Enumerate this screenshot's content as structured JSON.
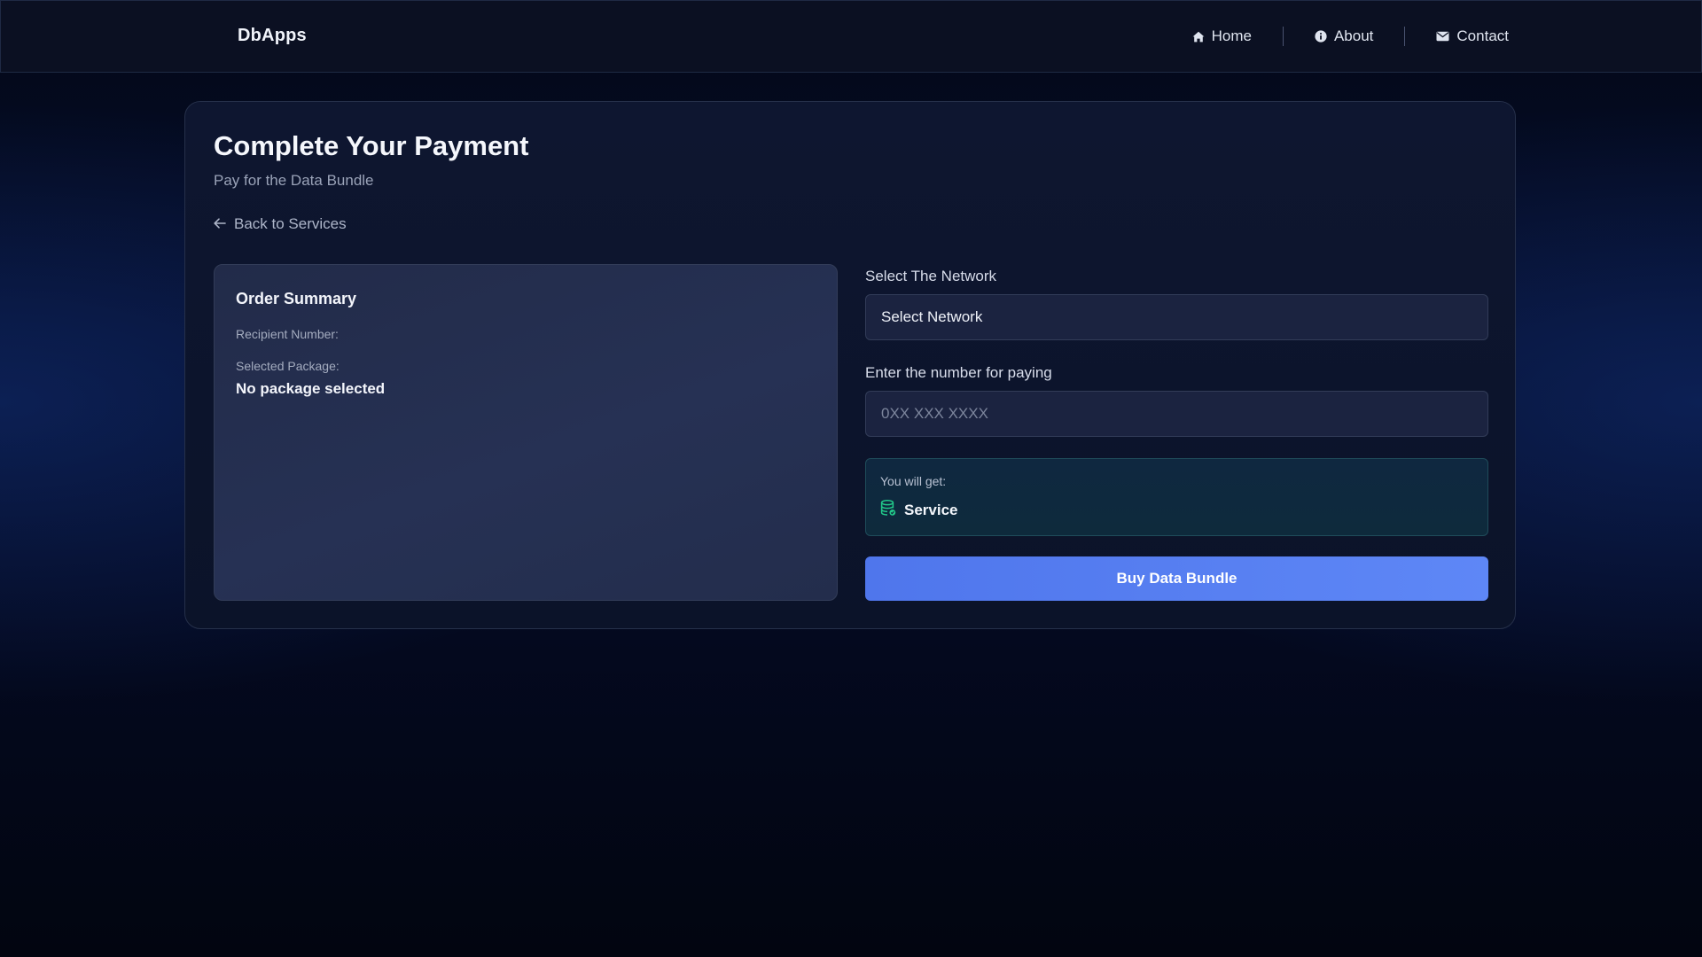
{
  "navbar": {
    "brand": "DbApps",
    "links": [
      {
        "label": "Home",
        "icon": "home-icon"
      },
      {
        "label": "About",
        "icon": "info-icon"
      },
      {
        "label": "Contact",
        "icon": "envelope-icon"
      }
    ]
  },
  "page": {
    "title": "Complete Your Payment",
    "subtitle": "Pay for the Data Bundle",
    "back_link": {
      "label": "Back to Services",
      "icon": "arrow-left-icon"
    }
  },
  "order_summary": {
    "title": "Order Summary",
    "recipient_label": "Recipient Number:",
    "recipient_value": "",
    "package_label": "Selected Package:",
    "package_value": "No package selected"
  },
  "form": {
    "network_label": "Select The Network",
    "network_selected": "Select Network",
    "paying_label": "Enter the number for paying",
    "paying_placeholder": "0XX XXX XXXX",
    "paying_value": ""
  },
  "result": {
    "label": "You will get:",
    "service": "Service",
    "icon": "database-icon"
  },
  "buy_button": {
    "label": "Buy Data Bundle"
  },
  "colors": {
    "accent": "#5a82f3",
    "service_icon": "#22c98a"
  }
}
